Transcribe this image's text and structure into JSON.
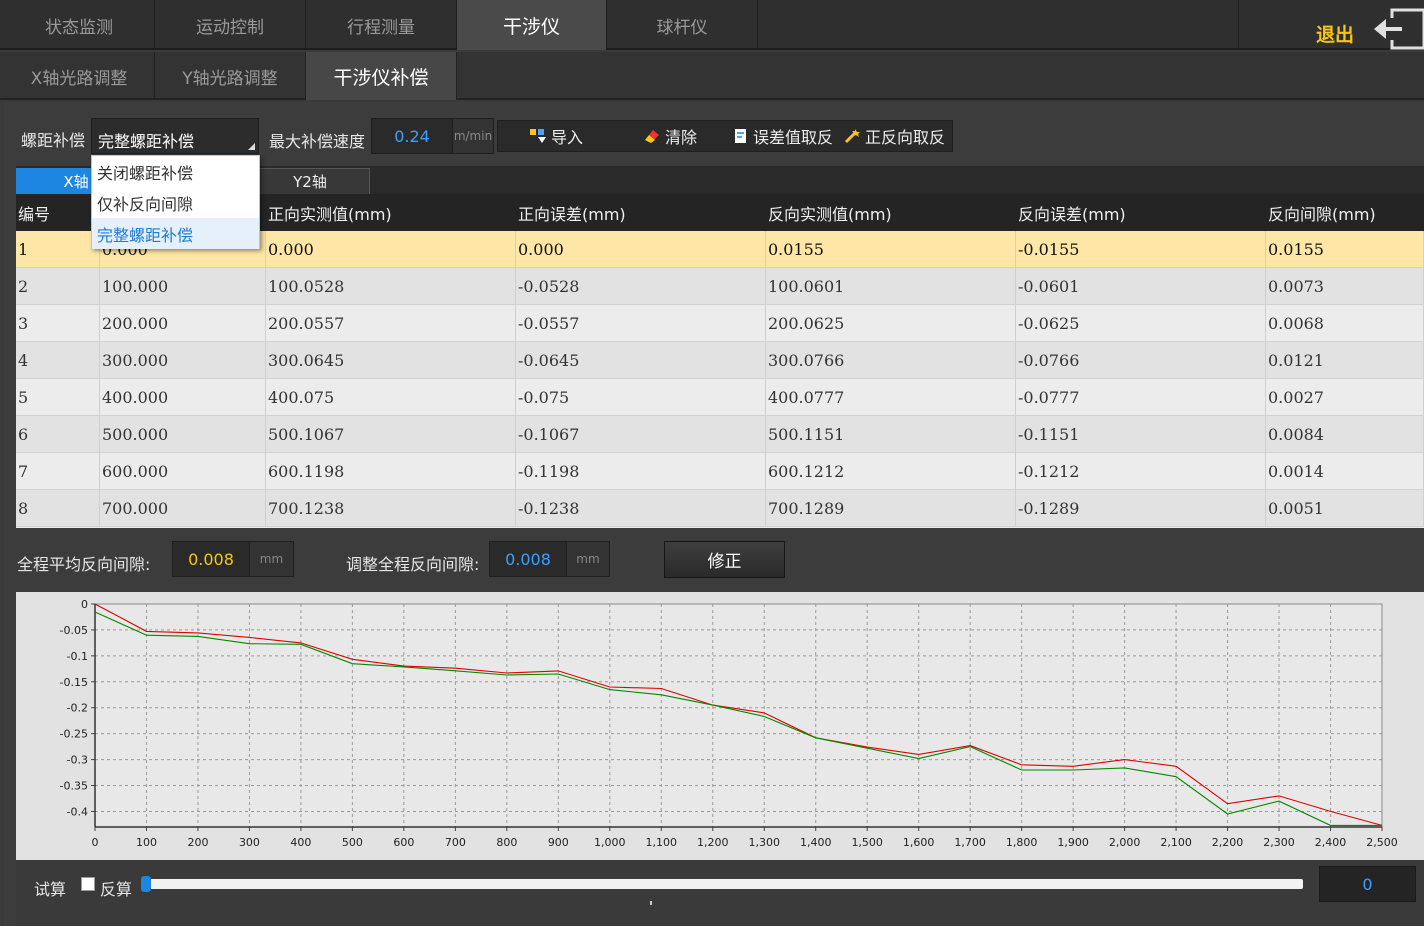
{
  "top_tabs": [
    {
      "label": "状态监测"
    },
    {
      "label": "运动控制"
    },
    {
      "label": "行程测量"
    },
    {
      "label": "干涉仪"
    },
    {
      "label": "球杆仪"
    }
  ],
  "exit_label": "退出",
  "sub_tabs": [
    {
      "label": "X轴光路调整"
    },
    {
      "label": "Y轴光路调整"
    },
    {
      "label": "干涉仪补偿"
    }
  ],
  "controls": {
    "pitch_label": "螺距补偿",
    "pitch_selected": "完整螺距补偿",
    "pitch_options": [
      "关闭螺距补偿",
      "仅补反向间隙",
      "完整螺距补偿"
    ],
    "speed_label": "最大补偿速度",
    "speed_value": "0.24",
    "speed_unit": "m/min",
    "import_label": "导入",
    "clear_label": "清除",
    "negate_error_label": "误差值取反",
    "reverse_dir_label": "正反向取反"
  },
  "axis_tabs": [
    {
      "label": "X轴"
    },
    {
      "label": "Y2轴"
    }
  ],
  "table": {
    "headers": [
      "编号",
      "",
      "正向实测值(mm)",
      "正向误差(mm)",
      "反向实测值(mm)",
      "反向误差(mm)",
      "反向间隙(mm)"
    ],
    "rows": [
      [
        "1",
        "0.000",
        "0.000",
        "0.000",
        "0.0155",
        "-0.0155",
        "0.0155"
      ],
      [
        "2",
        "100.000",
        "100.0528",
        "-0.0528",
        "100.0601",
        "-0.0601",
        "0.0073"
      ],
      [
        "3",
        "200.000",
        "200.0557",
        "-0.0557",
        "200.0625",
        "-0.0625",
        "0.0068"
      ],
      [
        "4",
        "300.000",
        "300.0645",
        "-0.0645",
        "300.0766",
        "-0.0766",
        "0.0121"
      ],
      [
        "5",
        "400.000",
        "400.075",
        "-0.075",
        "400.0777",
        "-0.0777",
        "0.0027"
      ],
      [
        "6",
        "500.000",
        "500.1067",
        "-0.1067",
        "500.1151",
        "-0.1151",
        "0.0084"
      ],
      [
        "7",
        "600.000",
        "600.1198",
        "-0.1198",
        "600.1212",
        "-0.1212",
        "0.0014"
      ],
      [
        "8",
        "700.000",
        "700.1238",
        "-0.1238",
        "700.1289",
        "-0.1289",
        "0.0051"
      ]
    ]
  },
  "backlash": {
    "avg_label": "全程平均反向间隙:",
    "avg_value": "0.008",
    "avg_unit": "mm",
    "adjust_label": "调整全程反向间隙:",
    "adjust_value": "0.008",
    "adjust_unit": "mm",
    "fix_label": "修正"
  },
  "chart_data": {
    "type": "line",
    "title": "",
    "xlabel": "",
    "ylabel": "",
    "xlim": [
      0,
      2500
    ],
    "ylim": [
      -0.43,
      0
    ],
    "xticks": [
      "0",
      "100",
      "200",
      "300",
      "400",
      "500",
      "600",
      "700",
      "800",
      "900",
      "1,000",
      "1,100",
      "1,200",
      "1,300",
      "1,400",
      "1,500",
      "1,600",
      "1,700",
      "1,800",
      "1,900",
      "2,000",
      "2,100",
      "2,200",
      "2,300",
      "2,400",
      "2,500"
    ],
    "yticks": [
      "0",
      "-0.05",
      "-0.1",
      "-0.15",
      "-0.2",
      "-0.25",
      "-0.3",
      "-0.35",
      "-0.4"
    ],
    "grid": true,
    "colors": {
      "forward": "#e00000",
      "reverse": "#008a00"
    },
    "x": [
      0,
      100,
      200,
      300,
      400,
      500,
      600,
      700,
      800,
      900,
      1000,
      1100,
      1200,
      1300,
      1400,
      1500,
      1600,
      1700,
      1800,
      1900,
      2000,
      2100,
      2200,
      2300,
      2400,
      2500
    ],
    "series": [
      {
        "values": [
          0,
          -0.0528,
          -0.0557,
          -0.0645,
          -0.075,
          -0.1067,
          -0.1198,
          -0.1238,
          -0.133,
          -0.129,
          -0.16,
          -0.163,
          -0.195,
          -0.21,
          -0.258,
          -0.276,
          -0.29,
          -0.273,
          -0.31,
          -0.313,
          -0.3,
          -0.313,
          -0.385,
          -0.37,
          -0.4,
          -0.427
        ]
      },
      {
        "values": [
          -0.0155,
          -0.0601,
          -0.0625,
          -0.0766,
          -0.0777,
          -0.1151,
          -0.1212,
          -0.1289,
          -0.137,
          -0.135,
          -0.165,
          -0.175,
          -0.195,
          -0.217,
          -0.258,
          -0.278,
          -0.298,
          -0.275,
          -0.32,
          -0.32,
          -0.316,
          -0.333,
          -0.405,
          -0.38,
          -0.427,
          -0.427
        ]
      }
    ]
  },
  "trial": {
    "trial_label": "试算",
    "reverse_label": "反算",
    "value": "0"
  }
}
